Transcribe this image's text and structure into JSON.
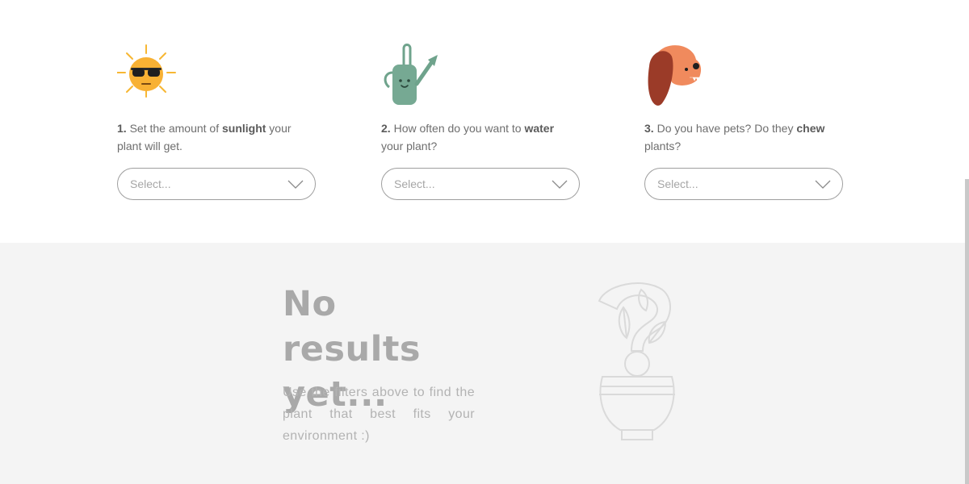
{
  "filters": [
    {
      "icon": "sun-with-sunglasses-icon",
      "number": "1.",
      "text_before": " Set the amount of ",
      "bold": "sunlight",
      "text_after": " your plant will get.",
      "select_placeholder": "Select..."
    },
    {
      "icon": "watering-can-icon",
      "number": "2.",
      "text_before": " How often do you want to ",
      "bold": "water",
      "text_after": " your plant?",
      "select_placeholder": "Select..."
    },
    {
      "icon": "dog-icon",
      "number": "3.",
      "text_before": " Do you have pets? Do they ",
      "bold": "chew",
      "text_after": " plants?",
      "select_placeholder": "Select..."
    }
  ],
  "results": {
    "title": "No results yet...",
    "subtitle": "Use the filters above to find the plant that best fits your environment :)",
    "illustration": "plant-question-mark-icon"
  },
  "colors": {
    "sun": "#f7b733",
    "watering_can": "#6fa38c",
    "dog": "#f08a5d",
    "dog_ear": "#9b3b28",
    "empty_state_bg": "#f4f4f4",
    "muted_text": "#a9a9a9"
  }
}
